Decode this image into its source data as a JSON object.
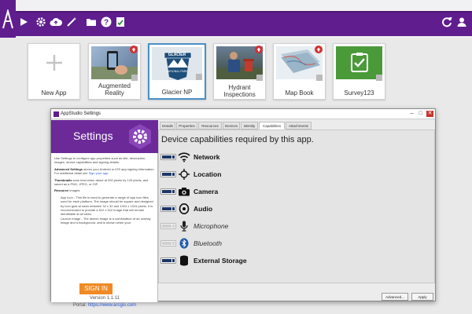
{
  "colors": {
    "brand": "#5f1d8e",
    "header": "#6b2a98",
    "sign_in": "#f08a24",
    "toggle_on": "#1e3766",
    "badge": "#d32f2f"
  },
  "toolbar": {
    "left_icons": [
      "play-icon",
      "gear-icon",
      "cloud-upload-icon",
      "wand-icon",
      "folder-icon",
      "help-icon",
      "certificate-icon"
    ],
    "right_icons": [
      "refresh-icon",
      "user-icon"
    ]
  },
  "tiles": [
    {
      "name": "New App",
      "icon": "plus-icon",
      "badge": false
    },
    {
      "name": "Augmented Reality",
      "badge": true
    },
    {
      "name": "Glacier NP",
      "badge": true,
      "selected": true,
      "logo": {
        "line1": "GLACIER",
        "line2": "NATIONAL PARK"
      }
    },
    {
      "name": "Hydrant Inspections",
      "badge": true
    },
    {
      "name": "Map Book",
      "badge": true
    },
    {
      "name": "Survey123",
      "badge": false
    }
  ],
  "dialog": {
    "title": "AppStudio Settings",
    "window_buttons": {
      "minimize": "–",
      "maximize": "□",
      "close": "✕"
    },
    "left": {
      "title": "Settings",
      "intro": "Use Settings to configure app properties such as title, description, images, device capabilities and signing details.",
      "advanced_bold": "Advanced Settings",
      "advanced": " stores your Android or iOS app signing information. For additional detail see ",
      "advanced_link": "Sign your app",
      "thumb_bold": "Thumbnails",
      "thumb": " work best when about at 200 pixels by 133 pixels, and saved as a PNG, JPEG, or GIF.",
      "res_bold": "Resource",
      "res": " images:",
      "bullet1": "App Icon - This file is used to generate a range of app icon files used for each platform. The image should be square and designed by icon guid at sizes between 32 x 32 and 1024 x 1024 pixels. It is recommended to provide a 512 x 512 image that will remain identifiable at all sizes.",
      "bullet2": "Launch Image - The launch image is a combination of an overlay image and a background, and is shown when your",
      "sign_in": "SIGN IN",
      "version": "Version 1.1.11",
      "portal_label": "Portal: ",
      "portal_url": "https://www.arcgis.com"
    },
    "tabs": [
      "Details",
      "Properties",
      "Resources",
      "Devices",
      "Identity",
      "Capabilities",
      "Attachments"
    ],
    "active_tab": "Capabilities",
    "heading": "Device capabilities required by this app.",
    "capabilities": [
      {
        "name": "Network",
        "enabled": true,
        "icon": "wifi-icon"
      },
      {
        "name": "Location",
        "enabled": true,
        "icon": "crosshair-icon"
      },
      {
        "name": "Camera",
        "enabled": true,
        "icon": "camera-icon"
      },
      {
        "name": "Audio",
        "enabled": true,
        "icon": "speaker-icon"
      },
      {
        "name": "Microphone",
        "enabled": false,
        "icon": "microphone-icon"
      },
      {
        "name": "Bluetooth",
        "enabled": false,
        "icon": "bluetooth-icon"
      },
      {
        "name": "External Storage",
        "enabled": true,
        "icon": "database-icon"
      }
    ],
    "buttons": {
      "advanced": "Advanced...",
      "apply": "Apply"
    }
  }
}
